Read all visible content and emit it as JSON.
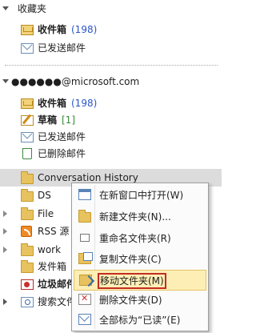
{
  "favorites": {
    "header": "收藏夹",
    "items": [
      {
        "label": "收件箱",
        "count": "(198)",
        "icon": "inbox-icon"
      },
      {
        "label": "已发送邮件",
        "icon": "sent-mail-icon"
      }
    ]
  },
  "account": {
    "email": "●●●●●●@microsoft.com",
    "items": [
      {
        "label": "收件箱",
        "count": "(198)",
        "icon": "inbox-icon"
      },
      {
        "label": "草稿",
        "count": "[1]",
        "icon": "drafts-icon"
      },
      {
        "label": "已发送邮件",
        "icon": "sent-mail-icon"
      },
      {
        "label": "已删除邮件",
        "icon": "trash-icon"
      },
      {
        "label": "Conversation History",
        "icon": "folder-icon"
      },
      {
        "label": "DS",
        "icon": "folder-icon"
      },
      {
        "label": "File",
        "icon": "folder-icon"
      },
      {
        "label": "RSS 源",
        "icon": "rss-icon"
      },
      {
        "label": "work",
        "icon": "folder-icon"
      },
      {
        "label": "发件箱",
        "icon": "outbox-icon"
      },
      {
        "label": "垃圾邮件",
        "icon": "junk-icon"
      },
      {
        "label": "搜索文件",
        "icon": "search-folder-icon"
      }
    ]
  },
  "context_menu": {
    "items": [
      {
        "label": "在新窗口中打开(W)",
        "icon": "new-window-icon"
      },
      {
        "label": "新建文件夹(N)...",
        "icon": "new-folder-icon"
      },
      {
        "label": "重命名文件夹(R)",
        "icon": "rename-icon"
      },
      {
        "label": "复制文件夹(C)",
        "icon": "copy-folder-icon"
      },
      {
        "label": "移动文件夹(M)",
        "icon": "move-folder-icon",
        "active": true
      },
      {
        "label": "删除文件夹(D)",
        "icon": "delete-folder-icon"
      },
      {
        "label": "全部标为“已读”(E)",
        "icon": "mark-read-icon"
      }
    ]
  },
  "colors": {
    "count_blue": "#2b55c9",
    "count_green": "#3a8a3a",
    "highlight_border": "#c32b23"
  }
}
